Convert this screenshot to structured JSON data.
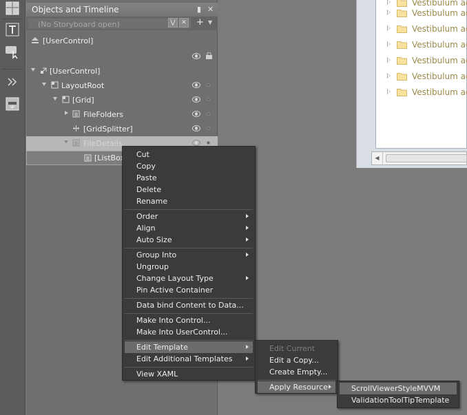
{
  "panel": {
    "title": "Objects and Timeline",
    "storyboard_placeholder": "(No Storyboard open)",
    "scope_label": "[UserControl]"
  },
  "tree": [
    {
      "label": "[UserControl]"
    },
    {
      "label": "LayoutRoot"
    },
    {
      "label": "[Grid]"
    },
    {
      "label": "FileFolders"
    },
    {
      "label": "[GridSplitter]"
    },
    {
      "label": "FileDetails"
    },
    {
      "label": "[ListBox"
    }
  ],
  "listbox": {
    "items": [
      "Vestibulum ad",
      "Vestibulum ad",
      "Vestibulum ad",
      "Vestibulum ad",
      "Vestibulum ad",
      "Vestibulum ad",
      "Vestibulum ad"
    ]
  },
  "context_menu": {
    "items": [
      "Cut",
      "Copy",
      "Paste",
      "Delete",
      "Rename",
      "Order",
      "Align",
      "Auto Size",
      "Group Into",
      "Ungroup",
      "Change Layout Type",
      "Pin Active Container",
      "Data bind Content to Data...",
      "Make Into Control...",
      "Make Into UserControl...",
      "Edit Template",
      "Edit Additional Templates",
      "View XAML"
    ]
  },
  "template_menu": {
    "items": [
      "Edit Current",
      "Edit a Copy...",
      "Create Empty...",
      "Apply Resource"
    ]
  },
  "resource_menu": {
    "items": [
      "ScrollViewerStyleMVVM",
      "ValidationToolTipTemplate"
    ]
  },
  "colors": {
    "menu_background": "#3b3b3b",
    "menu_highlight": "#6b6b6b",
    "panel_background": "#6f6f6f",
    "workspace_background": "#7b7b7b"
  }
}
